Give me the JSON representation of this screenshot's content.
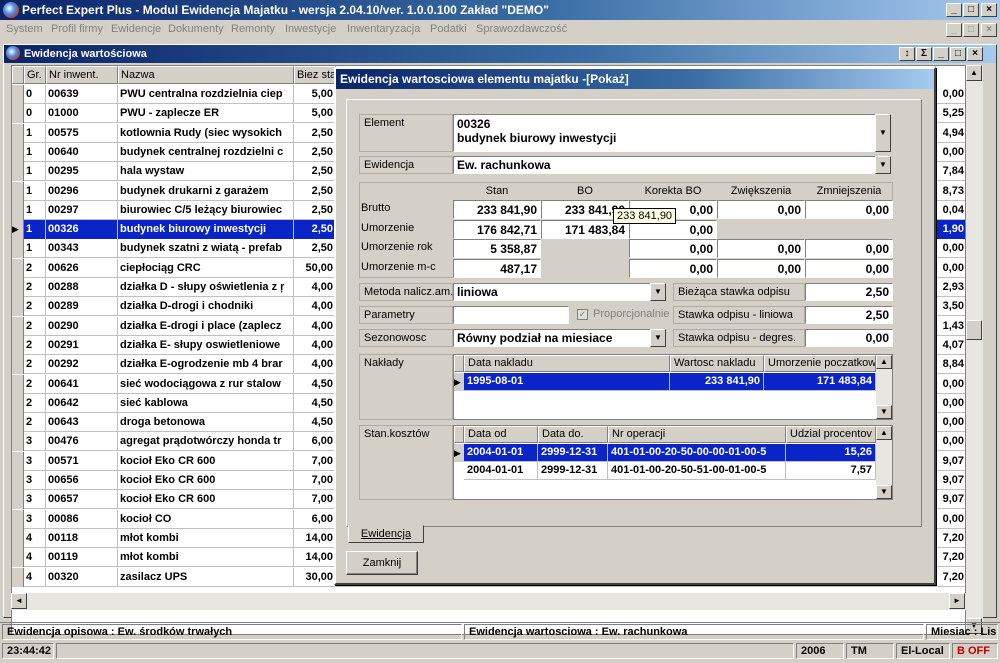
{
  "app": {
    "title": "Perfect Expert Plus - Modul Ewidencja Majatku - wersja 2.04.10/ver. 1.0.0.100 Zakład \"DEMO\""
  },
  "menu": [
    "System",
    "Profil firmy",
    "Ewidencje",
    "Dokumenty",
    "Remonty",
    "Inwestycje",
    "Inwentaryzacja",
    "Podatki",
    "Sprawozdawczość"
  ],
  "child": {
    "title": "Ewidencja wartościowa"
  },
  "grid": {
    "headers": [
      "Gr.",
      "Nr inwent.",
      "Nazwa",
      "Biez sta"
    ],
    "rows": [
      {
        "gr": "0",
        "nr": "00639",
        "nazwa": "PWU centralna rozdzielnia ciep",
        "biez": "5,00",
        "r": "0,00"
      },
      {
        "gr": "0",
        "nr": "01000",
        "nazwa": "PWU - zaplecze ER",
        "biez": "5,00",
        "r": "5,25"
      },
      {
        "gr": "1",
        "nr": "00575",
        "nazwa": "kotlownia Rudy (siec wysokich",
        "biez": "2,50",
        "r": "4,94"
      },
      {
        "gr": "1",
        "nr": "00640",
        "nazwa": "budynek centralnej rozdzielni c",
        "biez": "2,50",
        "r": "0,00"
      },
      {
        "gr": "1",
        "nr": "00295",
        "nazwa": "hala wystaw",
        "biez": "2,50",
        "r": "7,84"
      },
      {
        "gr": "1",
        "nr": "00296",
        "nazwa": "budynek drukarni z garażem",
        "biez": "2,50",
        "r": "8,73"
      },
      {
        "gr": "1",
        "nr": "00297",
        "nazwa": "biurowiec C/5 leżący biurowiec",
        "biez": "2,50",
        "r": "0,04"
      },
      {
        "gr": "1",
        "nr": "00326",
        "nazwa": "budynek biurowy inwestycji",
        "biez": "2,50",
        "r": "1,90"
      },
      {
        "gr": "1",
        "nr": "00343",
        "nazwa": "budynek szatni z wiatą - prefab",
        "biez": "2,50",
        "r": "0,00"
      },
      {
        "gr": "2",
        "nr": "00626",
        "nazwa": "ciepłociąg CRC",
        "biez": "50,00",
        "r": "0,00"
      },
      {
        "gr": "2",
        "nr": "00288",
        "nazwa": "działka D - słupy oświetlenia z ŗ",
        "biez": "4,00",
        "r": "2,93"
      },
      {
        "gr": "2",
        "nr": "00289",
        "nazwa": "działka D-drogi i chodniki",
        "biez": "4,00",
        "r": "3,50"
      },
      {
        "gr": "2",
        "nr": "00290",
        "nazwa": "działka E-drogi i place (zaplecz",
        "biez": "4,00",
        "r": "1,43"
      },
      {
        "gr": "2",
        "nr": "00291",
        "nazwa": "działka E- słupy oswietleniowe",
        "biez": "4,00",
        "r": "4,07"
      },
      {
        "gr": "2",
        "nr": "00292",
        "nazwa": "działka E-ogrodzenie mb 4 brar",
        "biez": "4,00",
        "r": "8,84"
      },
      {
        "gr": "2",
        "nr": "00641",
        "nazwa": "sieć wodociągowa z rur stalow",
        "biez": "4,50",
        "r": "0,00"
      },
      {
        "gr": "2",
        "nr": "00642",
        "nazwa": "sieć kablowa",
        "biez": "4,50",
        "r": "0,00"
      },
      {
        "gr": "2",
        "nr": "00643",
        "nazwa": "droga betonowa",
        "biez": "4,50",
        "r": "0,00"
      },
      {
        "gr": "3",
        "nr": "00476",
        "nazwa": "agregat prądotwórczy honda tr",
        "biez": "6,00",
        "r": "0,00"
      },
      {
        "gr": "3",
        "nr": "00571",
        "nazwa": "kocioł Eko CR 600",
        "biez": "7,00",
        "r": "9,07"
      },
      {
        "gr": "3",
        "nr": "00656",
        "nazwa": "kocioł Eko CR 600",
        "biez": "7,00",
        "r": "9,07"
      },
      {
        "gr": "3",
        "nr": "00657",
        "nazwa": "kocioł Eko CR 600",
        "biez": "7,00",
        "r": "9,07"
      },
      {
        "gr": "3",
        "nr": "00086",
        "nazwa": "kocioł CO",
        "biez": "6,00",
        "r": "0,00"
      },
      {
        "gr": "4",
        "nr": "00118",
        "nazwa": "młot kombi",
        "biez": "14,00",
        "r": "7,20"
      },
      {
        "gr": "4",
        "nr": "00119",
        "nazwa": "młot kombi",
        "biez": "14,00",
        "r": "7,20"
      },
      {
        "gr": "4",
        "nr": "00320",
        "nazwa": "zasilacz UPS",
        "biez": "30,00",
        "r": "7,20"
      }
    ]
  },
  "dialog": {
    "title": "Ewidencja wartosciowa elementu majatku -[Pokaż]",
    "element_label": "Element",
    "element_code": "00326",
    "element_name": "budynek biurowy inwestycji",
    "ewidencja_label": "Ewidencja",
    "ewidencja_value": "Ew. rachunkowa",
    "cols": [
      "Stan",
      "BO",
      "Korekta BO",
      "Zwiększenia",
      "Zmniejszenia"
    ],
    "rows": [
      {
        "label": "Brutto",
        "stan": "233 841,90",
        "bo": "233 841,90",
        "korekta": "0,00",
        "zw": "0,00",
        "zm": "0,00"
      },
      {
        "label": "Umorzenie",
        "stan": "176 842,71",
        "bo": "171 483,84",
        "korekta": "0,00",
        "zw": "",
        "zm": ""
      },
      {
        "label": "Umorzenie rok",
        "stan": "5 358,87",
        "bo": "",
        "korekta": "0,00",
        "zw": "0,00",
        "zm": "0,00"
      },
      {
        "label": "Umorzenie m-c",
        "stan": "487,17",
        "bo": "",
        "korekta": "0,00",
        "zw": "0,00",
        "zm": "0,00"
      }
    ],
    "tooltip": "233 841,90",
    "metoda_label": "Metoda nalicz.am.",
    "metoda_value": "liniowa",
    "parametry_label": "Parametry",
    "proporcjonalnie": "Proporcjonalnie",
    "sezonowosc_label": "Sezonowosc",
    "sezonowosc_value": "Równy podział na miesiace",
    "biezaca_label": "Bieżąca stawka odpisu",
    "biezaca_value": "2,50",
    "liniowa_label": "Stawka odpisu - liniowa",
    "liniowa_value": "2,50",
    "degres_label": "Stawka odpisu - degres.",
    "degres_value": "0,00",
    "naklady_label": "Nakłady",
    "naklady_headers": [
      "Data nakladu",
      "Wartosc nakladu",
      "Umorzenie poczatkow"
    ],
    "naklady_rows": [
      {
        "data": "1995-08-01",
        "wartosc": "233 841,90",
        "umorz": "171 483,84"
      }
    ],
    "stan_label": "Stan.kosztów",
    "stan_headers": [
      "Data od",
      "Data do.",
      "Nr operacji",
      "Udzial procentov"
    ],
    "stan_rows": [
      {
        "od": "2004-01-01",
        "do": "2999-12-31",
        "nr": "401-01-00-20-50-00-00-01-00-5",
        "udz": "15,26"
      },
      {
        "od": "2004-01-01",
        "do": "2999-12-31",
        "nr": "401-01-00-20-50-51-00-01-00-5",
        "udz": "7,57"
      }
    ],
    "tab_label": "Ewidencja",
    "close_label": "Zamknij"
  },
  "status": {
    "opisowa": "Ewidencja opisowa : Ew. środków  trwałych",
    "wartosciowa": "Ewidencja wartosciowa : Ew. rachunkowa",
    "miesiac": "Miesiac : Lis",
    "time": "23:44:42",
    "year": "2006",
    "tm": "TM",
    "local": "El-Local",
    "boff": "B OFF"
  }
}
